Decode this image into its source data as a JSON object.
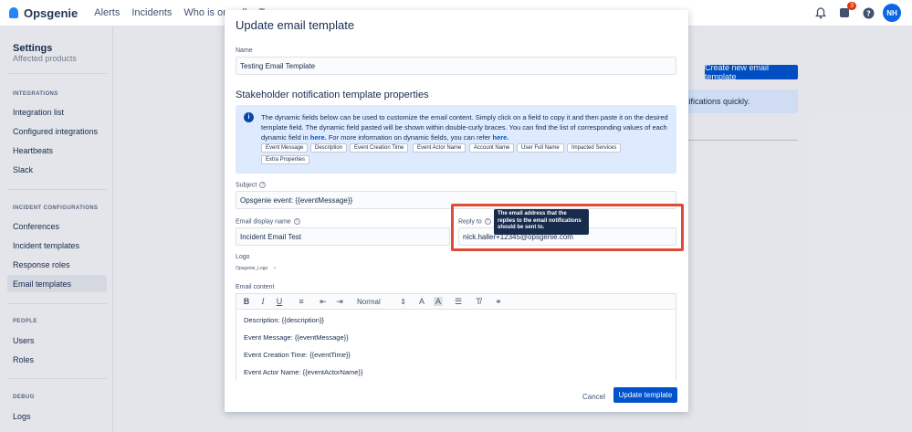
{
  "app": {
    "name": "Opsgenie",
    "user_initials": "NH",
    "notification_count": "3"
  },
  "nav": {
    "links": [
      "Alerts",
      "Incidents",
      "Who is on-call",
      "Teams"
    ]
  },
  "sidebar": {
    "title": "Settings",
    "cut_item": "Affected products",
    "sections": [
      {
        "label": "INTEGRATIONS",
        "items": [
          "Integration list",
          "Configured integrations",
          "Heartbeats",
          "Slack"
        ]
      },
      {
        "label": "INCIDENT CONFIGURATIONS",
        "items": [
          "Conferences",
          "Incident templates",
          "Response roles",
          "Email templates"
        ]
      },
      {
        "label": "PEOPLE",
        "items": [
          "Users",
          "Roles"
        ]
      },
      {
        "label": "DEBUG",
        "items": [
          "Logs"
        ]
      }
    ]
  },
  "background": {
    "create_button": "Create new email template",
    "info_fragment": "tifications quickly."
  },
  "modal": {
    "title": "Update email template",
    "name_label": "Name",
    "name_value": "Testing Email Template",
    "section_title": "Stakeholder notification template properties",
    "info": {
      "text1": "The dynamic fields below can be used to customize the email content. Simply click on a field to copy it and then paste it on the desired template field. The dynamic field pasted will be shown within double-curly braces. You can find the list of corresponding values of each dynamic field in",
      "link1": "here.",
      "text2": "For more information on dynamic fields, you can refer",
      "link2": "here.",
      "chips": [
        "Event Message",
        "Description",
        "Event Creation Time",
        "Event Actor Name",
        "Account Name",
        "User Full Name",
        "Impacted Services",
        "Extra Properties"
      ]
    },
    "subject_label": "Subject",
    "subject_value": "Opsgenie event: {{eventMessage}}",
    "display_name_label": "Email display name",
    "display_name_value": "Incident Email Test",
    "reply_to_label": "Reply to",
    "reply_to_value": "nick.haller+12345@opsgenie.com",
    "tooltip": "The email address that the replies to the email notifications should be sent to.",
    "logo_label": "Logo",
    "logo_file": "Opsgenie_Logo",
    "content_label": "Email content",
    "format_select": "Normal",
    "content_lines": [
      "Description: {{description}}",
      "Event Message: {{eventMessage}}",
      "Event Creation Time: {{eventTime}}",
      "Event Actor Name: {{eventActorName}}"
    ],
    "cancel_label": "Cancel",
    "update_label": "Update template"
  },
  "colors": {
    "primary": "#0052cc",
    "info_bg": "#deebff",
    "highlight": "#e04b38",
    "tooltip_bg": "#172b4d"
  }
}
